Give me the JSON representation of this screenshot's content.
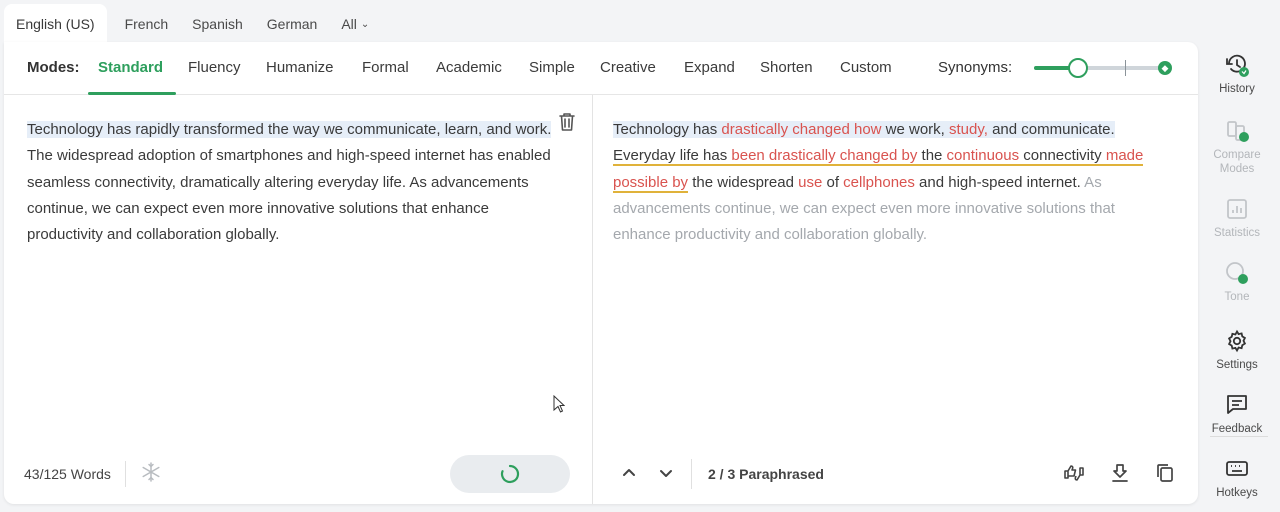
{
  "language_tabs": [
    "English (US)",
    "French",
    "Spanish",
    "German",
    "All"
  ],
  "modes": {
    "label": "Modes:",
    "items": [
      "Standard",
      "Fluency",
      "Humanize",
      "Formal",
      "Academic",
      "Simple",
      "Creative",
      "Expand",
      "Shorten",
      "Custom"
    ],
    "active": "Standard"
  },
  "synonyms": {
    "label": "Synonyms:",
    "level": 0.3
  },
  "input": {
    "sentence1": "Technology has rapidly transformed the way we communicate, learn, and work.",
    "rest": " The widespread adoption of smartphones and high-speed internet has enabled seamless connectivity, dramatically altering everyday life. As advancements continue, we can expect even more innovative solutions that enhance productivity and collaboration globally.",
    "word_count": "43/125 Words"
  },
  "output": {
    "s1_a": "Technology has ",
    "s1_b": "drastically changed how",
    "s1_c": " we work, ",
    "s1_d": "study,",
    "s1_e": " and communicate.",
    "s2_a": "Everyday life has ",
    "s2_b": "been drastically changed by",
    "s2_c": " the ",
    "s2_d": "continuous",
    "s2_e": " connectivity ",
    "s2_f": "made possible by",
    "s2_g": " the widespread ",
    "s2_h": "use",
    "s2_i": " of ",
    "s2_j": "cellphones",
    "s2_k": " and high-speed internet.",
    "pending": " As advancements continue, we can expect even more innovative solutions that enhance productivity and collaboration globally.",
    "status": "2 / 3 Paraphrased"
  },
  "sidebar": [
    "History",
    "Compare Modes",
    "Statistics",
    "Tone",
    "Settings",
    "Feedback",
    "Hotkeys"
  ],
  "colors": {
    "accent": "#2e9f5d",
    "changed": "#d9534f",
    "structure": "#e0b23a",
    "highlight": "#e6eef8"
  }
}
